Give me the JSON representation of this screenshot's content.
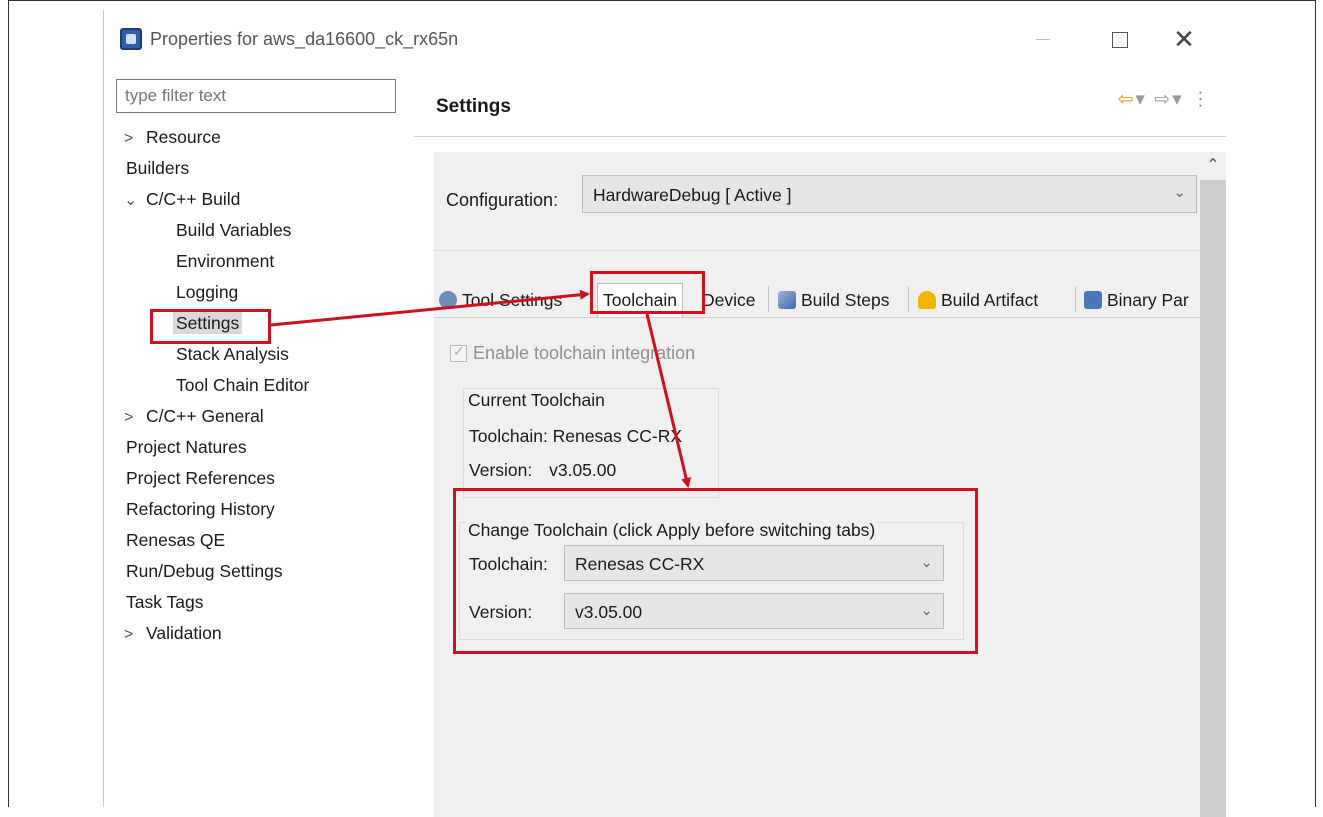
{
  "window": {
    "title": "Properties for aws_da16600_ck_rx65n",
    "close_glyph": "✕"
  },
  "filter": {
    "placeholder": "type filter text"
  },
  "tree": {
    "items": [
      {
        "label": "Resource",
        "arrow": ">"
      },
      {
        "label": "Builders",
        "arrow": ""
      },
      {
        "label": "C/C++ Build",
        "arrow": "✓"
      },
      {
        "label": "Build Variables",
        "arrow": ""
      },
      {
        "label": "Environment",
        "arrow": ""
      },
      {
        "label": "Logging",
        "arrow": ""
      },
      {
        "label": "Settings",
        "arrow": ""
      },
      {
        "label": "Stack Analysis",
        "arrow": ""
      },
      {
        "label": "Tool Chain Editor",
        "arrow": ""
      },
      {
        "label": "C/C++ General",
        "arrow": ">"
      },
      {
        "label": "Project Natures",
        "arrow": ""
      },
      {
        "label": "Project References",
        "arrow": ""
      },
      {
        "label": "Refactoring History",
        "arrow": ""
      },
      {
        "label": "Renesas QE",
        "arrow": ""
      },
      {
        "label": "Run/Debug Settings",
        "arrow": ""
      },
      {
        "label": "Task Tags",
        "arrow": ""
      },
      {
        "label": "Validation",
        "arrow": ">"
      }
    ]
  },
  "pane": {
    "title": "Settings",
    "configuration_label": "Configuration:",
    "configuration_value": "HardwareDebug  [ Active ]"
  },
  "tabs": {
    "tool_settings": "Tool Settings",
    "toolchain": "Toolchain",
    "device": "Device",
    "build_steps": "Build Steps",
    "build_artifact": "Build Artifact",
    "binary_parsers": "Binary Par"
  },
  "toolchain_tab": {
    "enable_label": "Enable toolchain integration",
    "current_group_title": "Current Toolchain",
    "current_toolchain": "Toolchain:  Renesas CC-RX",
    "current_version_label": "Version:",
    "current_version_value": "v3.05.00",
    "change_group_title": "Change Toolchain (click Apply before switching tabs)",
    "toolchain_label": "Toolchain:",
    "toolchain_value": "Renesas CC-RX",
    "version_label": "Version:",
    "version_value": "v3.05.00"
  },
  "colors": {
    "annotation": "#d0101c",
    "content_bg": "#f0f0f0",
    "selected_tree_bg": "#d9d9d9"
  }
}
